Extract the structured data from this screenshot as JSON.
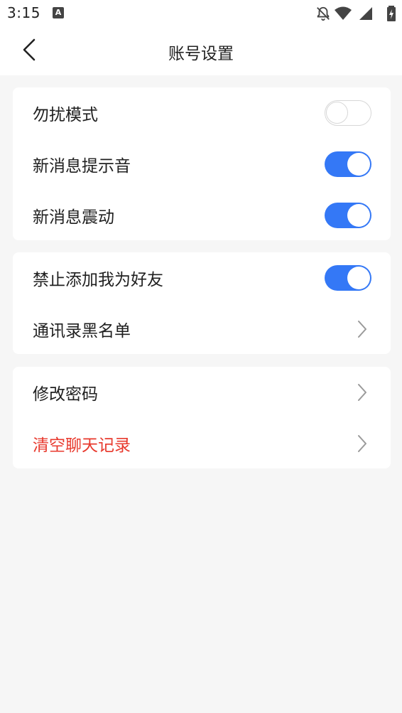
{
  "status_bar": {
    "time": "3:15",
    "notification_glyph": "A",
    "icons": [
      "bell-off-icon",
      "wifi-icon",
      "signal-icon",
      "battery-charging-icon"
    ]
  },
  "header": {
    "title": "账号设置",
    "back_icon": "chevron-left-icon"
  },
  "groups": [
    {
      "items": [
        {
          "label": "勿扰模式",
          "type": "toggle",
          "on": false
        },
        {
          "label": "新消息提示音",
          "type": "toggle",
          "on": true
        },
        {
          "label": "新消息震动",
          "type": "toggle",
          "on": true
        }
      ]
    },
    {
      "items": [
        {
          "label": "禁止添加我为好友",
          "type": "toggle",
          "on": true
        },
        {
          "label": "通讯录黑名单",
          "type": "link"
        }
      ]
    },
    {
      "items": [
        {
          "label": "修改密码",
          "type": "link"
        },
        {
          "label": "清空聊天记录",
          "type": "link",
          "danger": true
        }
      ]
    }
  ],
  "colors": {
    "accent": "#3478f6",
    "danger": "#e8392d",
    "background": "#f6f6f6",
    "card": "#ffffff",
    "text": "#1f1f1f"
  }
}
